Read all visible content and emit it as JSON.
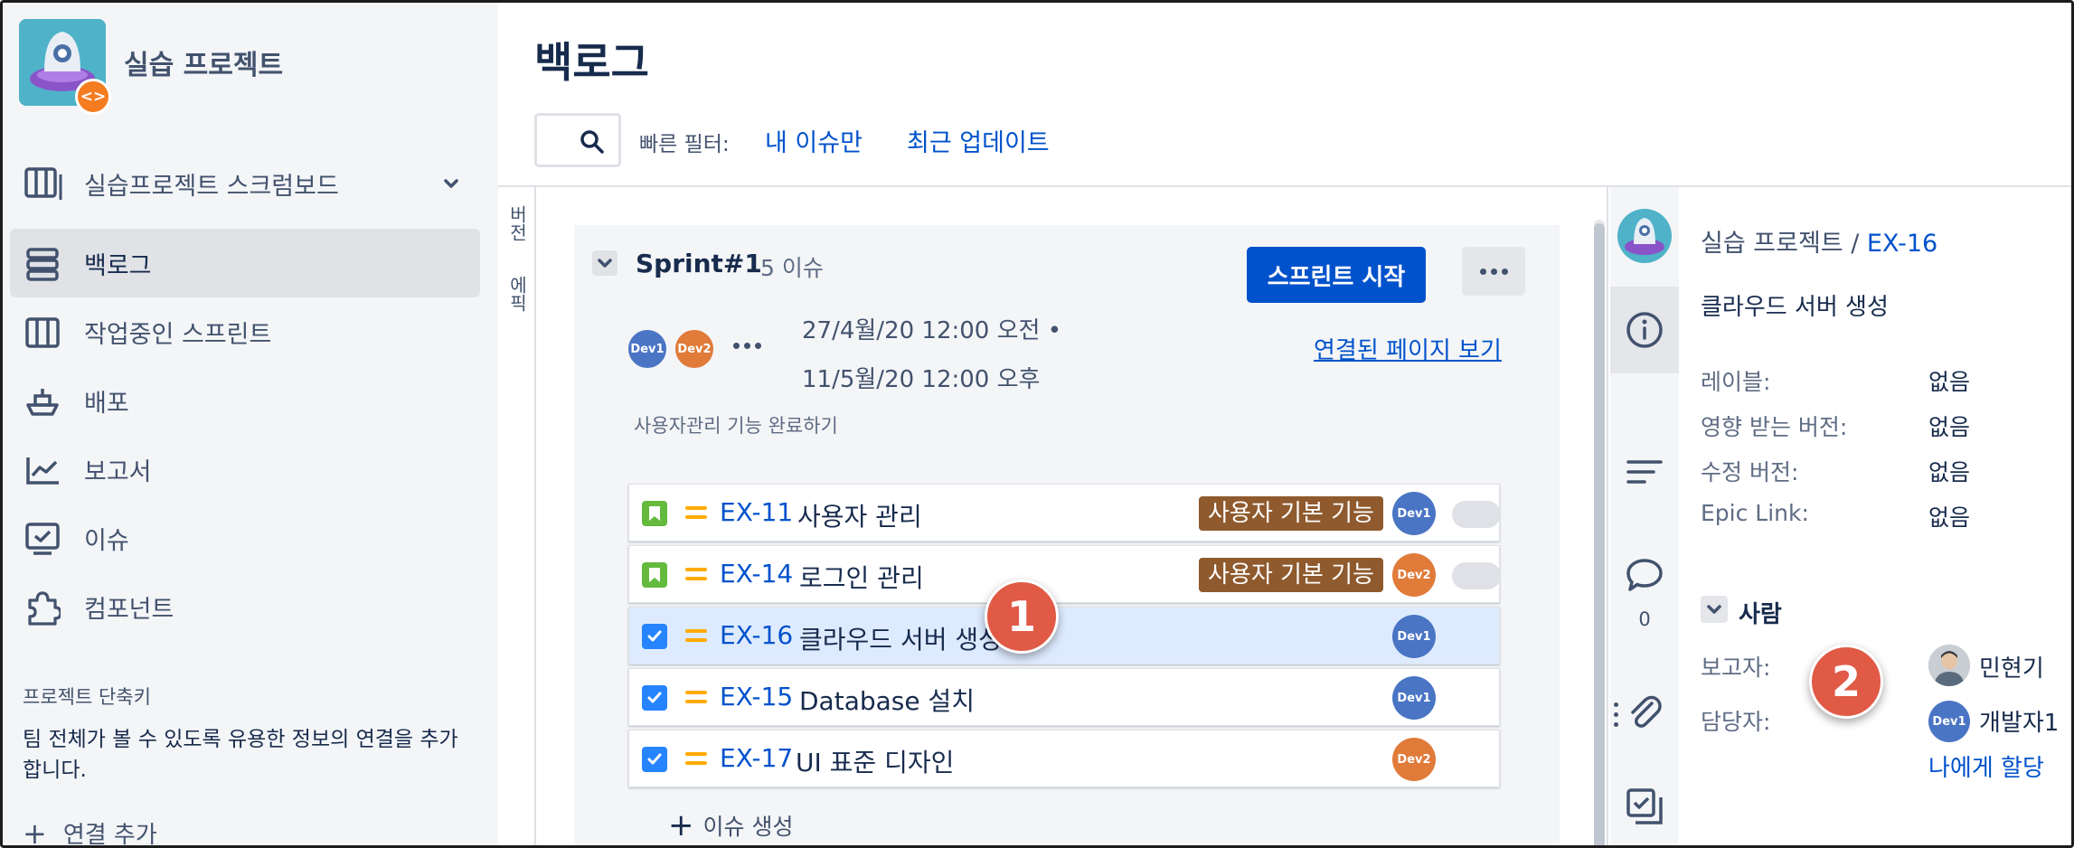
{
  "project": {
    "name": "실습 프로젝트",
    "badge": "<>"
  },
  "sidebar": {
    "board_switcher": "실습프로젝트 스크럼보드",
    "items": [
      {
        "label": "백로그",
        "icon": "backlog-icon",
        "active": true
      },
      {
        "label": "작업중인 스프린트",
        "icon": "board-icon",
        "active": false
      },
      {
        "label": "배포",
        "icon": "ship-icon",
        "active": false
      },
      {
        "label": "보고서",
        "icon": "chart-line-icon",
        "active": false
      },
      {
        "label": "이슈",
        "icon": "issues-icon",
        "active": false
      },
      {
        "label": "컴포넌트",
        "icon": "puzzle-icon",
        "active": false
      }
    ],
    "shortcuts_title": "프로젝트 단축키",
    "shortcuts_desc": "팀 전체가 볼 수 있도록 유용한 정보의 연결을 추가합니다.",
    "add_link": "연결 추가"
  },
  "header": {
    "title": "백로그",
    "quick_filter_label": "빠른 필터:",
    "filters": [
      "내 이슈만",
      "최근 업데이트"
    ]
  },
  "vertical_tabs": [
    "버전",
    "에픽"
  ],
  "sprint": {
    "name": "Sprint#1",
    "count": "5 이슈",
    "start_button": "스프린트 시작",
    "assignees": [
      "Dev1",
      "Dev2"
    ],
    "date_start": "27/4월/20 12:00 오전  •",
    "date_end": "11/5월/20 12:00 오후",
    "linked_pages": "연결된 페이지 보기",
    "goal": "사용자관리 기능 완료하기",
    "issues": [
      {
        "key": "EX-11",
        "summary": "사용자 관리",
        "type": "story",
        "epic": "사용자 기본 기능",
        "assignee": "Dev1",
        "selected": false
      },
      {
        "key": "EX-14",
        "summary": "로그인 관리",
        "type": "story",
        "epic": "사용자 기본 기능",
        "assignee": "Dev2",
        "selected": false
      },
      {
        "key": "EX-16",
        "summary": "클라우드 서버 생성",
        "type": "task",
        "epic": "",
        "assignee": "Dev1",
        "selected": true
      },
      {
        "key": "EX-15",
        "summary": "Database 설치",
        "type": "task",
        "epic": "",
        "assignee": "Dev1",
        "selected": false
      },
      {
        "key": "EX-17",
        "summary": "UI 표준 디자인",
        "type": "task",
        "epic": "",
        "assignee": "Dev2",
        "selected": false
      }
    ],
    "create_issue": "이슈 생성"
  },
  "detail": {
    "project_crumb": "실습 프로젝트 /",
    "issue_key": "EX-16",
    "title": "클라우드 서버 생성",
    "comment_count": "0",
    "fields": [
      {
        "label": "레이블:",
        "value": "없음"
      },
      {
        "label": "영향 받는 버전:",
        "value": "없음"
      },
      {
        "label": "수정 버전:",
        "value": "없음"
      },
      {
        "label": "Epic Link:",
        "value": "없음"
      }
    ],
    "people_title": "사람",
    "reporter_label": "보고자:",
    "reporter_name": "민현기",
    "assignee_label": "담당자:",
    "assignee_name": "개발자1",
    "assignee_avatar": "Dev1",
    "assign_to_me": "나에게 할당"
  },
  "callouts": [
    "1",
    "2"
  ],
  "colors": {
    "brand": "#0052cc",
    "dev1": "#4a75c4",
    "dev2": "#e07b39",
    "epic": "#8f5a2d",
    "callout": "#e05a46"
  }
}
